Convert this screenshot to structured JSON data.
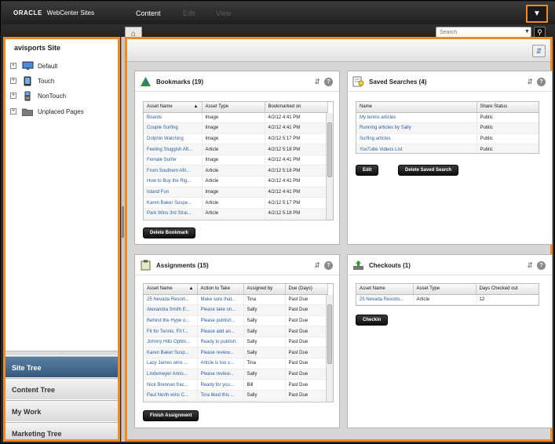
{
  "header": {
    "brand": "ORACLE",
    "product": "WebCenter Sites",
    "nav": [
      "Content",
      "Edit",
      "View"
    ],
    "menu_icon": "menu-down-icon"
  },
  "search": {
    "placeholder": "Search"
  },
  "sidebar": {
    "site_name": "avisports Site",
    "tree": [
      {
        "label": "Default",
        "icon": "monitor-icon"
      },
      {
        "label": "Touch",
        "icon": "tablet-icon"
      },
      {
        "label": "NonTouch",
        "icon": "phone-icon"
      },
      {
        "label": "Unplaced Pages",
        "icon": "folder-icon"
      }
    ],
    "accordion": [
      "Site Tree",
      "Content Tree",
      "My Work",
      "Marketing Tree"
    ]
  },
  "bookmarks": {
    "title": "Bookmarks (19)",
    "columns": [
      "Asset Name",
      "Asset Type",
      "Bookmarked on"
    ],
    "rows": [
      [
        "Boards",
        "Image",
        "4/2/12 4:41 PM"
      ],
      [
        "Couple Surfing",
        "Image",
        "4/2/12 4:41 PM"
      ],
      [
        "Dolphin Watching",
        "Image",
        "4/2/12 5:17 PM"
      ],
      [
        "Feeling Sluggish Aft...",
        "Article",
        "4/2/12 5:18 PM"
      ],
      [
        "Female Surfer",
        "Image",
        "4/2/12 4:41 PM"
      ],
      [
        "From Southern Afri...",
        "Article",
        "4/2/12 5:18 PM"
      ],
      [
        "How to Buy the Rig...",
        "Article",
        "4/2/12 4:41 PM"
      ],
      [
        "Island Fun",
        "Image",
        "4/2/12 4:41 PM"
      ],
      [
        "Karen Baker Suspe...",
        "Article",
        "4/2/12 5:17 PM"
      ],
      [
        "Park Wins 3rd Strai...",
        "Article",
        "4/2/12 5:18 PM"
      ]
    ],
    "button": "Delete Bookmark"
  },
  "saved_searches": {
    "title": "Saved Searches (4)",
    "columns": [
      "Name",
      "Share Status"
    ],
    "rows": [
      [
        "My tennis articles",
        "Public"
      ],
      [
        "Running articles by Sally",
        "Public"
      ],
      [
        "Surfing articles",
        "Public"
      ],
      [
        "YouTube Videos List",
        "Public"
      ]
    ],
    "edit_button": "Edit",
    "delete_button": "Delete Saved Search"
  },
  "assignments": {
    "title": "Assignments (15)",
    "columns": [
      "Asset Name",
      "Action to Take",
      "Assigned by",
      "Due (Days)"
    ],
    "rows": [
      [
        "25 Nevada Resort...",
        "Make sure that...",
        "Tina",
        "Past Due"
      ],
      [
        "Alexandra Smith E...",
        "Please take on...",
        "Sally",
        "Past Due"
      ],
      [
        "Behind the Hype o...",
        "Please publish...",
        "Sally",
        "Past Due"
      ],
      [
        "Fit for Tennis, Fit f...",
        "Please add an...",
        "Sally",
        "Past Due"
      ],
      [
        "Johnny Hills Optim...",
        "Ready to publish.",
        "Sally",
        "Past Due"
      ],
      [
        "Karen Baker Susp...",
        "Please review...",
        "Sally",
        "Past Due"
      ],
      [
        "Lacy James wins ...",
        "Article is too s...",
        "Tina",
        "Past Due"
      ],
      [
        "Lindemeyer Anno...",
        "Please review...",
        "Sally",
        "Past Due"
      ],
      [
        "Nick Brennan frac...",
        "Ready for you...",
        "Bill",
        "Past Due"
      ],
      [
        "Paul North wins C...",
        "Tina liked this ...",
        "Sally",
        "Past Due"
      ]
    ],
    "button": "Finish Assignment"
  },
  "checkouts": {
    "title": "Checkouts (1)",
    "columns": [
      "Asset Name",
      "Asset Type",
      "Days Checked out"
    ],
    "rows": [
      [
        "25 Nevada Resorts...",
        "Article",
        "12"
      ]
    ],
    "button": "Checkin"
  },
  "colors": {
    "accent": "#f08a24",
    "link": "#2a5d9f",
    "active_tab": "#35587c"
  }
}
